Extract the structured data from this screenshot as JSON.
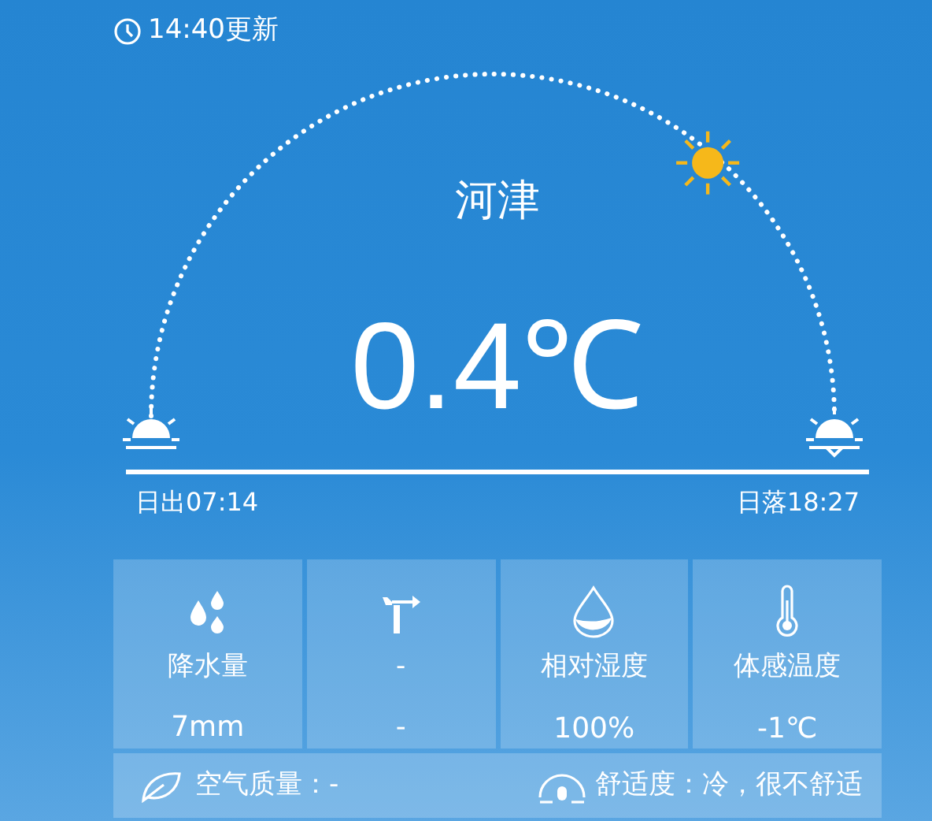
{
  "update_time": "14:40更新",
  "city": "河津",
  "temperature": "0.4℃",
  "sunrise": "日出07:14",
  "sunset": "日落18:27",
  "stats": [
    {
      "kind": "rain",
      "label": "降水量",
      "value": "7mm"
    },
    {
      "kind": "wind",
      "label": "-",
      "value": "-"
    },
    {
      "kind": "humidity",
      "label": "相对湿度",
      "value": "100%"
    },
    {
      "kind": "feels",
      "label": "体感温度",
      "value": "-1℃"
    }
  ],
  "air_quality": "空气质量：-",
  "comfort": "舒适度：冷，很不舒适"
}
